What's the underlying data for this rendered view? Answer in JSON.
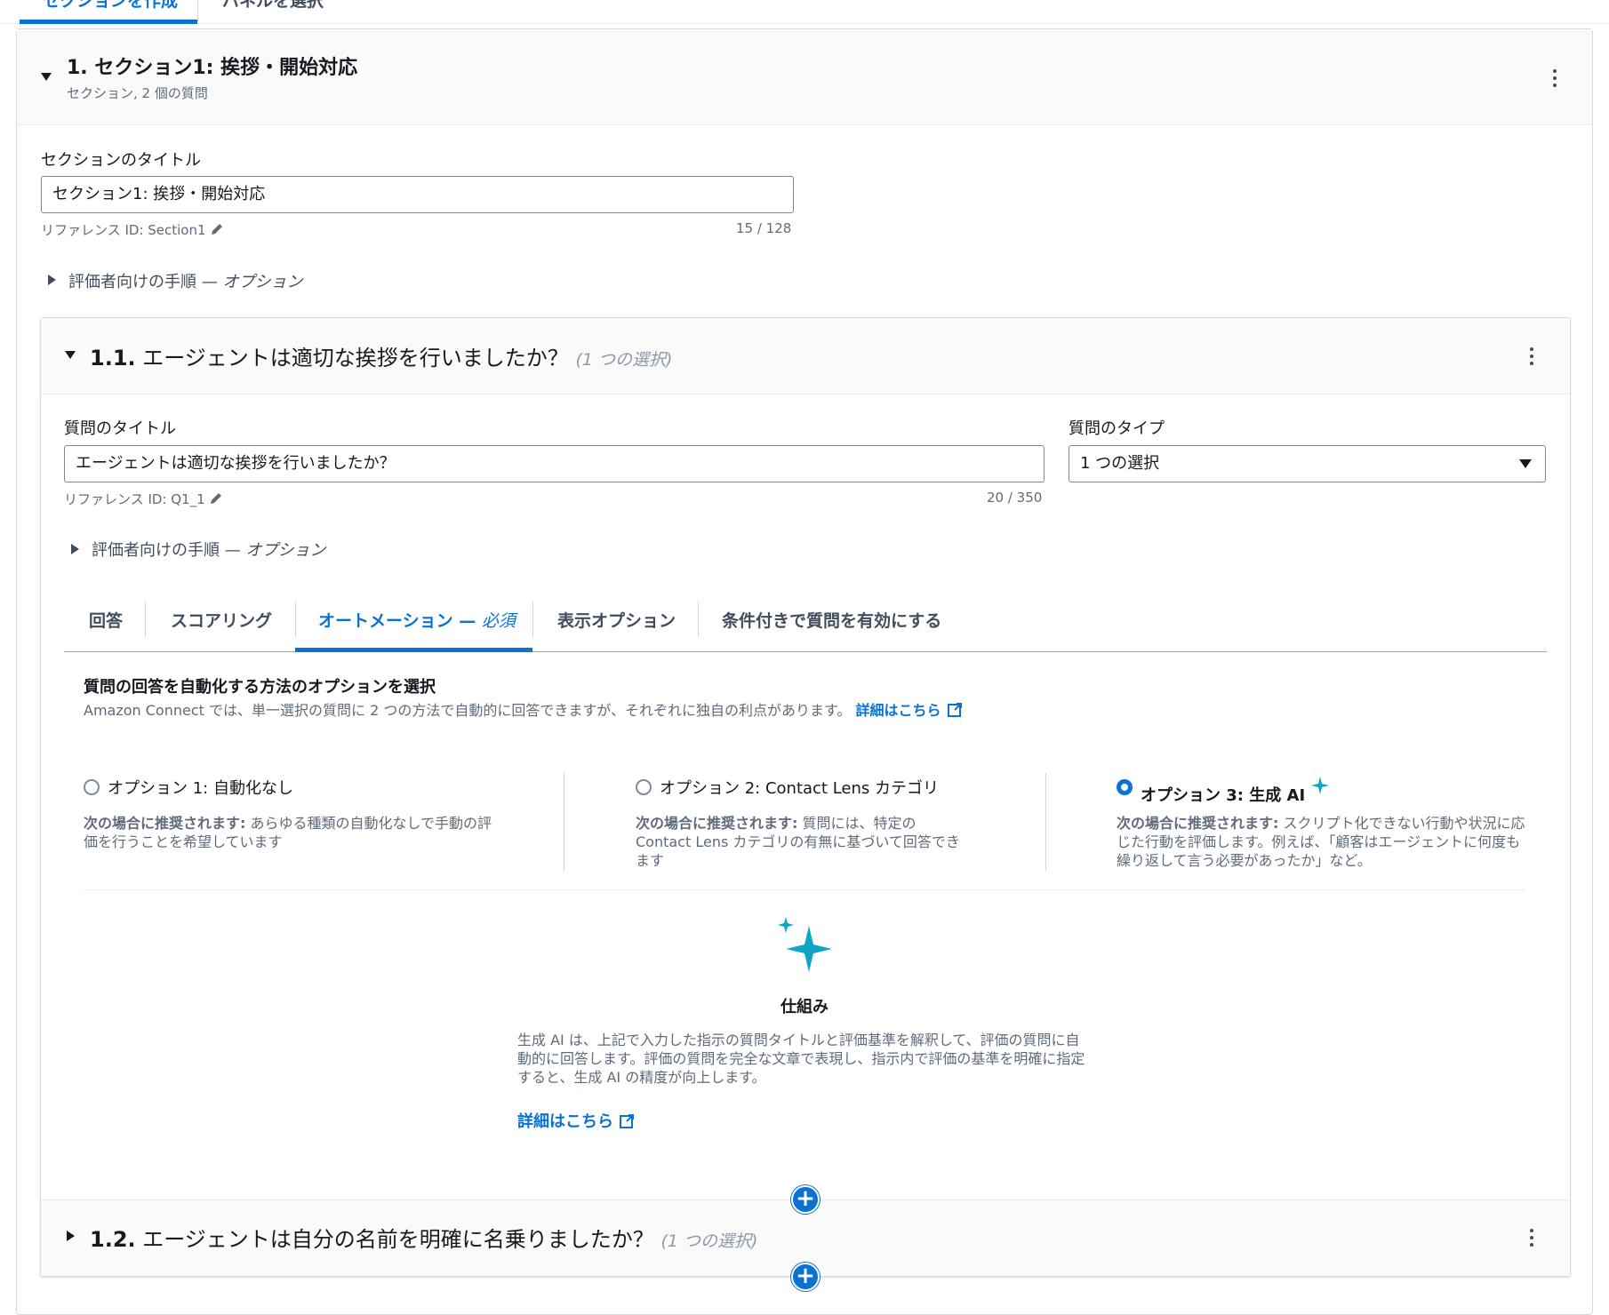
{
  "top_tabs": [
    {
      "label": "セクションを作成"
    },
    {
      "label": "パネルを選択"
    }
  ],
  "section": {
    "title": "1. セクション1: 挨拶・開始対応",
    "subtitle": "セクション, 2 個の質問",
    "title_field_label": "セクションのタイトル",
    "title_value": "セクション1: 挨拶・開始対応",
    "reference_id": "リファレンス ID: Section1",
    "char_count": "15 / 128",
    "instructions_toggle": "評価者向けの手順 —",
    "instructions_optional": "オプション"
  },
  "question1": {
    "number": "1.1.",
    "title": "エージェントは適切な挨拶を行いましたか？",
    "type_hint": "(1 つの選択)",
    "title_field_label": "質問のタイトル",
    "title_value": "エージェントは適切な挨拶を行いましたか？",
    "reference_id": "リファレンス ID: Q1_1",
    "char_count": "20 / 350",
    "type_field_label": "質問のタイプ",
    "type_value": "1 つの選択",
    "instructions_toggle": "評価者向けの手順 —",
    "instructions_optional": "オプション"
  },
  "tabs": [
    {
      "label": "回答"
    },
    {
      "label": "スコアリング"
    },
    {
      "label": "オートメーション —",
      "suffix": "必須",
      "active": true
    },
    {
      "label": "表示オプション"
    },
    {
      "label": "条件付きで質問を有効にする"
    }
  ],
  "automation": {
    "heading": "質問の回答を自動化する方法のオプションを選択",
    "description": "Amazon Connect では、単一選択の質問に 2 つの方法で自動的に回答できますが、それぞれに独自の利点があります。",
    "learn_more": "詳細はこちら",
    "recommended_prefix": "次の場合に推奨されます:",
    "options": [
      {
        "title": "オプション 1: 自動化なし",
        "desc": "あらゆる種類の自動化なしで手動の評価を行うことを希望しています",
        "selected": false
      },
      {
        "title": "オプション 2: Contact Lens カテゴリ",
        "desc": "質問には、特定の Contact Lens カテゴリの有無に基づいて回答できます",
        "selected": false
      },
      {
        "title": "オプション 3: 生成 AI",
        "desc": "スクリプト化できない行動や状況に応じた行動を評価します。例えば、「顧客はエージェントに何度も繰り返して言う必要があったか」など。",
        "selected": true
      }
    ],
    "how_title": "仕組み",
    "how_desc": "生成 AI は、上記で入力した指示の質問タイトルと評価基準を解釈して、評価の質問に自動的に回答します。評価の質問を完全な文章で表現し、指示内で評価の基準を明確に指定すると、生成 AI の精度が向上します。",
    "how_learn_more": "詳細はこちら"
  },
  "question2": {
    "number": "1.2.",
    "title": "エージェントは自分の名前を明確に名乗りましたか？",
    "type_hint": "(1 つの選択)"
  },
  "add_button_label": "+",
  "colors": {
    "accent": "#0972d3",
    "sparkle": "#0ea5c6"
  }
}
